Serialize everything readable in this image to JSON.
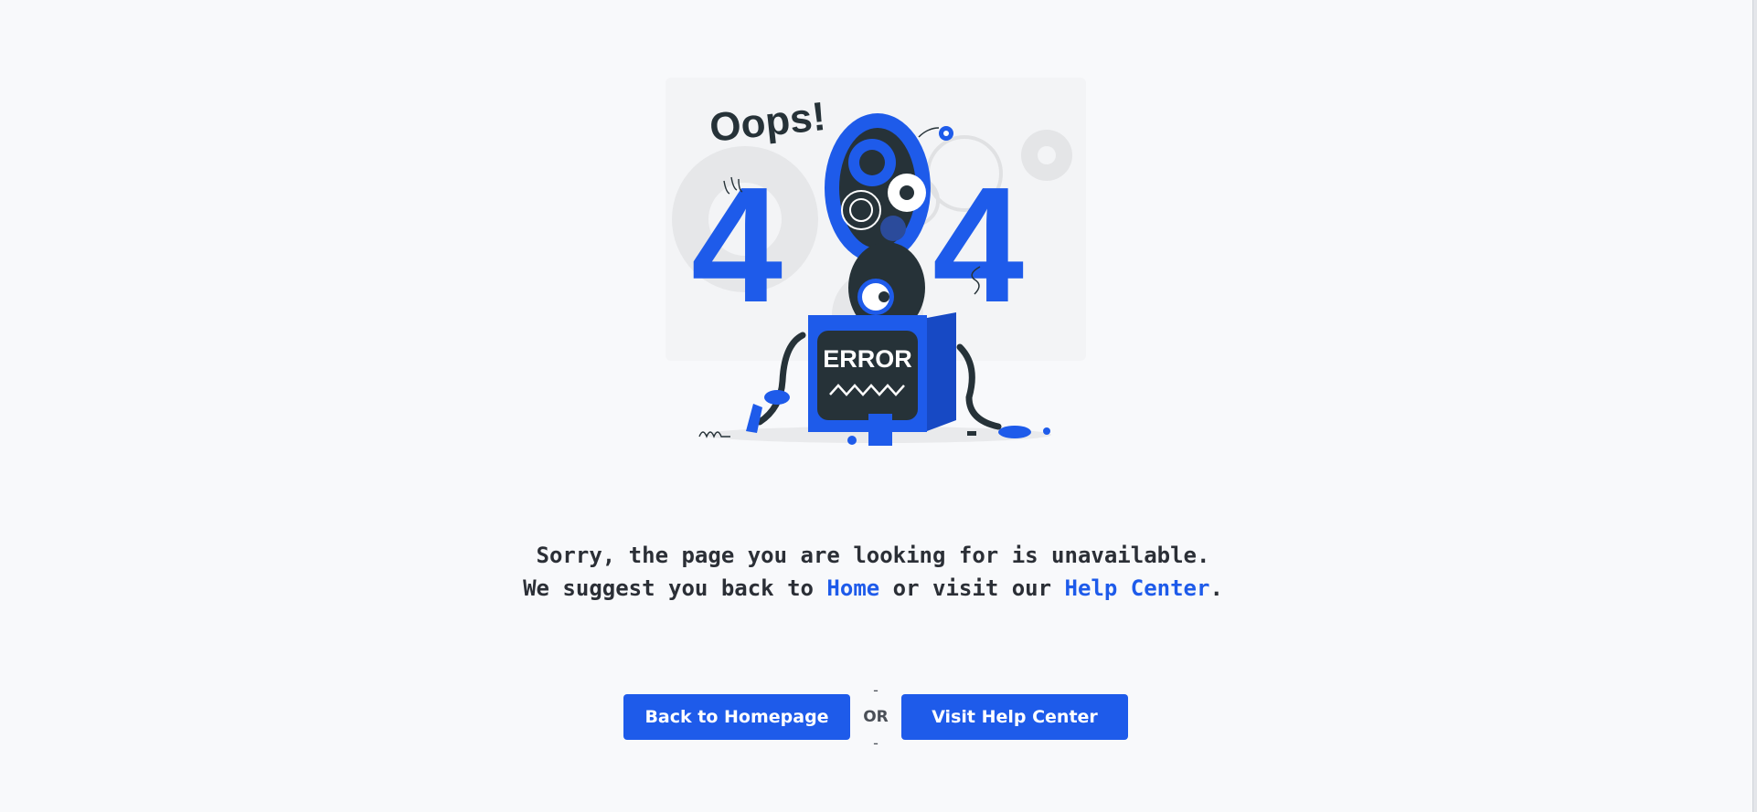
{
  "illustration": {
    "headline": "Oops!",
    "digit_left": "4",
    "digit_right": "4",
    "screen_label": "ERROR",
    "colors": {
      "accent": "#1e5bea",
      "dark": "#263238",
      "light_gear": "#ebebeb"
    }
  },
  "message": {
    "line1": "Sorry, the page you are looking for is unavailable.",
    "line2_prefix": "We suggest you back to ",
    "home_link": "Home",
    "line2_middle": " or visit our ",
    "help_link": "Help Center",
    "line2_suffix": "."
  },
  "actions": {
    "home_button": "Back to Homepage",
    "separator_top": "-",
    "separator_text": "OR",
    "separator_bottom": "-",
    "help_button": "Visit Help Center"
  }
}
